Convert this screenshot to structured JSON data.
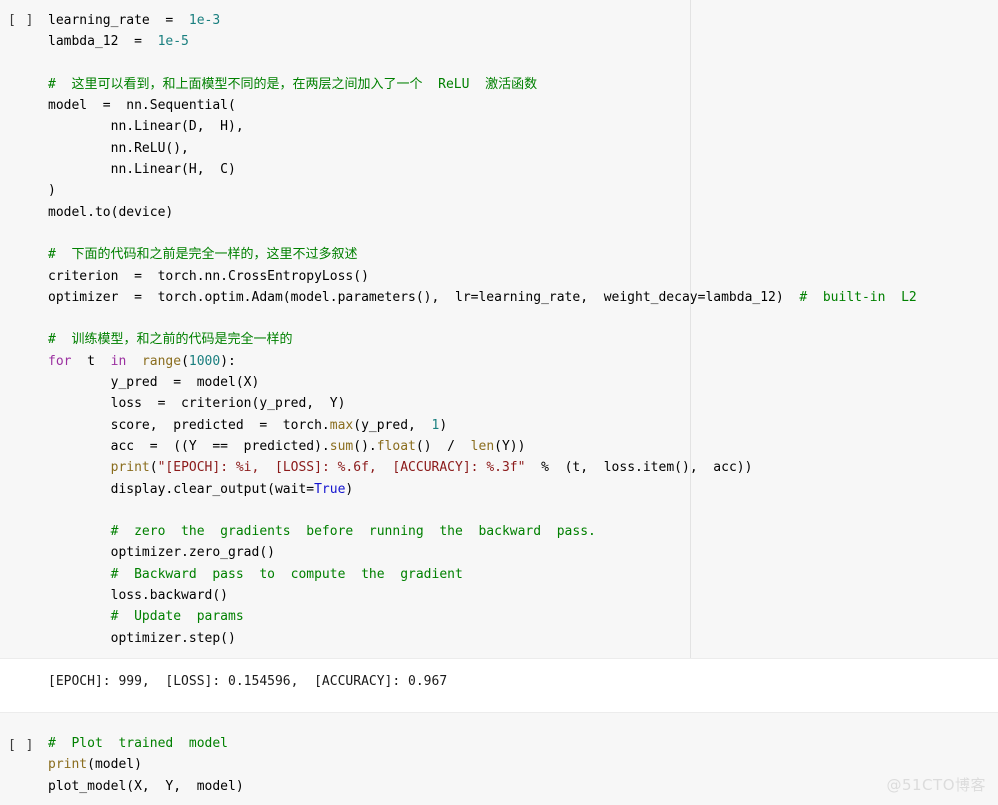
{
  "watermark": "@51CTO博客",
  "colors": {
    "cell_background": "#f7f7f7",
    "output_background": "#ffffff",
    "comment": "#008000",
    "number": "#1a7f7f",
    "keyword": "#9b30a0",
    "builtin": "#8a6d1e",
    "string": "#8b1a1a",
    "constant": "#1414cf",
    "plain": "#000000",
    "ruler": "#e3e3e3",
    "watermark": "#dcdcdc"
  },
  "cells": [
    {
      "prompt": "[ ]",
      "lines": [
        [
          {
            "t": "learning_rate  =  ",
            "c": "pln"
          },
          {
            "t": "1e-3",
            "c": "num"
          }
        ],
        [
          {
            "t": "lambda_12  =  ",
            "c": "pln"
          },
          {
            "t": "1e-5",
            "c": "num"
          }
        ],
        [],
        [
          {
            "t": "#  这里可以看到，和上面模型不同的是，在两层之间加入了一个  ReLU  激活函数",
            "c": "com"
          }
        ],
        [
          {
            "t": "model  =  nn.Sequential(",
            "c": "pln"
          }
        ],
        [
          {
            "t": "        nn.Linear(D,  H),",
            "c": "pln"
          }
        ],
        [
          {
            "t": "        nn.ReLU(),",
            "c": "pln"
          }
        ],
        [
          {
            "t": "        nn.Linear(H,  C)",
            "c": "pln"
          }
        ],
        [
          {
            "t": ")",
            "c": "pln"
          }
        ],
        [
          {
            "t": "model.to(device)",
            "c": "pln"
          }
        ],
        [],
        [
          {
            "t": "#  下面的代码和之前是完全一样的，这里不过多叙述",
            "c": "com"
          }
        ],
        [
          {
            "t": "criterion  =  torch.nn.CrossEntropyLoss()",
            "c": "pln"
          }
        ],
        [
          {
            "t": "optimizer  =  torch.optim.Adam(model.parameters(),  lr=learning_rate,  weight_decay=lambda_12)  ",
            "c": "pln"
          },
          {
            "t": "#  built-in  L2",
            "c": "com"
          }
        ],
        [],
        [
          {
            "t": "#  训练模型，和之前的代码是完全一样的",
            "c": "com"
          }
        ],
        [
          {
            "t": "for",
            "c": "kw"
          },
          {
            "t": "  t  ",
            "c": "pln"
          },
          {
            "t": "in",
            "c": "kw"
          },
          {
            "t": "  ",
            "c": "pln"
          },
          {
            "t": "range",
            "c": "bi"
          },
          {
            "t": "(",
            "c": "pln"
          },
          {
            "t": "1000",
            "c": "num"
          },
          {
            "t": "):",
            "c": "pln"
          }
        ],
        [
          {
            "t": "        y_pred  =  model(X)",
            "c": "pln"
          }
        ],
        [
          {
            "t": "        loss  =  criterion(y_pred,  Y)",
            "c": "pln"
          }
        ],
        [
          {
            "t": "        score,  predicted  =  torch.",
            "c": "pln"
          },
          {
            "t": "max",
            "c": "bi"
          },
          {
            "t": "(y_pred,  ",
            "c": "pln"
          },
          {
            "t": "1",
            "c": "num"
          },
          {
            "t": ")",
            "c": "pln"
          }
        ],
        [
          {
            "t": "        acc  =  ((Y  ==  predicted).",
            "c": "pln"
          },
          {
            "t": "sum",
            "c": "bi"
          },
          {
            "t": "().",
            "c": "pln"
          },
          {
            "t": "float",
            "c": "bi"
          },
          {
            "t": "()  /  ",
            "c": "pln"
          },
          {
            "t": "len",
            "c": "bi"
          },
          {
            "t": "(Y))",
            "c": "pln"
          }
        ],
        [
          {
            "t": "        ",
            "c": "pln"
          },
          {
            "t": "print",
            "c": "bi"
          },
          {
            "t": "(",
            "c": "pln"
          },
          {
            "t": "\"[EPOCH]: %i,  [LOSS]: %.6f,  [ACCURACY]: %.3f\"",
            "c": "str"
          },
          {
            "t": "  %  (t,  loss.item(),  acc))",
            "c": "pln"
          }
        ],
        [
          {
            "t": "        display.clear_output(wait=",
            "c": "pln"
          },
          {
            "t": "True",
            "c": "cst"
          },
          {
            "t": ")",
            "c": "pln"
          }
        ],
        [],
        [
          {
            "t": "        #  zero  the  gradients  before  running  the  backward  pass.",
            "c": "com"
          }
        ],
        [
          {
            "t": "        optimizer.zero_grad()",
            "c": "pln"
          }
        ],
        [
          {
            "t": "        #  Backward  pass  to  compute  the  gradient",
            "c": "com"
          }
        ],
        [
          {
            "t": "        loss.backward()",
            "c": "pln"
          }
        ],
        [
          {
            "t": "        #  Update  params",
            "c": "com"
          }
        ],
        [
          {
            "t": "        optimizer.step()",
            "c": "pln"
          }
        ]
      ],
      "output": "[EPOCH]: 999,  [LOSS]: 0.154596,  [ACCURACY]: 0.967"
    },
    {
      "prompt": "[ ]",
      "lines": [
        [
          {
            "t": "#  Plot  trained  model",
            "c": "com"
          }
        ],
        [
          {
            "t": "print",
            "c": "bi"
          },
          {
            "t": "(model)",
            "c": "pln"
          }
        ],
        [
          {
            "t": "plot_model(X,  Y,  model)",
            "c": "pln"
          }
        ]
      ],
      "output": null
    }
  ]
}
